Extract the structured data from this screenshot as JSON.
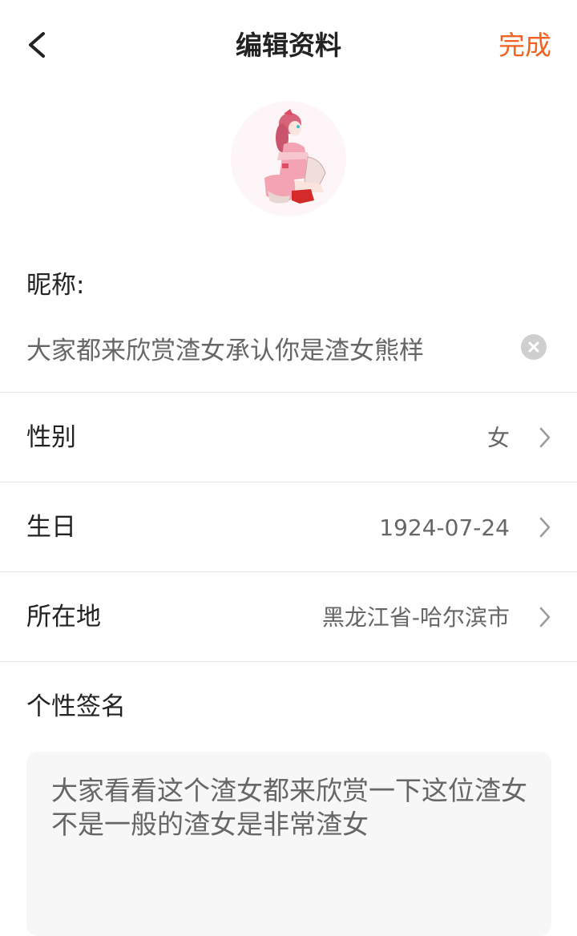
{
  "header": {
    "back_icon": "chevron-left-icon",
    "title": "编辑资料",
    "done_label": "完成",
    "done_color": "#f3621f"
  },
  "avatar": {
    "icon": "anime-character-avatar"
  },
  "nickname": {
    "label": "昵称:",
    "value": "大家都来欣赏渣女承认你是渣女熊样",
    "clear_icon": "clear-circle-icon"
  },
  "rows": [
    {
      "label": "性别",
      "value": "女",
      "icon": "chevron-right-icon"
    },
    {
      "label": "生日",
      "value": "1924-07-24",
      "icon": "chevron-right-icon"
    },
    {
      "label": "所在地",
      "value": "黑龙江省-哈尔滨市",
      "icon": "chevron-right-icon"
    }
  ],
  "signature": {
    "label": "个性签名",
    "value": "大家看看这个渣女都来欣赏一下这位渣女不是一般的渣女是非常渣女"
  }
}
